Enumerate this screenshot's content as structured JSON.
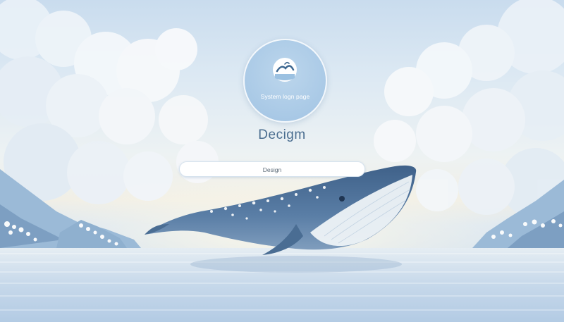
{
  "logo": {
    "caption": "System logn page",
    "icon": "wave-icon"
  },
  "title": "Decigm",
  "field": {
    "value": "Design"
  },
  "colors": {
    "sky": "#c9dcee",
    "horizon_glow": "#f1efe6",
    "title_text": "#4a6d8f",
    "logo_circle": "#a9c9e6",
    "whale_body": "#4d6f95"
  }
}
